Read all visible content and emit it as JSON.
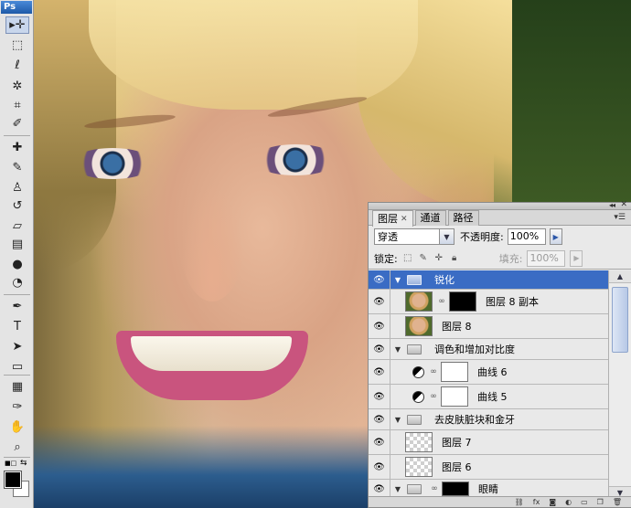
{
  "app": {
    "logo": "Ps"
  },
  "toolbox": {
    "tools": [
      {
        "name": "move-tool-icon",
        "glyph": "▸✛"
      },
      {
        "name": "marquee-tool-icon",
        "glyph": "⬚"
      },
      {
        "name": "lasso-tool-icon",
        "glyph": "ℓ"
      },
      {
        "name": "magic-wand-tool-icon",
        "glyph": "✲"
      },
      {
        "name": "crop-tool-icon",
        "glyph": "⌗"
      },
      {
        "name": "eyedropper-tool-icon",
        "glyph": "✐"
      },
      {
        "name": "healing-brush-tool-icon",
        "glyph": "✚"
      },
      {
        "name": "brush-tool-icon",
        "glyph": "✎"
      },
      {
        "name": "clone-stamp-tool-icon",
        "glyph": "♙"
      },
      {
        "name": "history-brush-tool-icon",
        "glyph": "↺"
      },
      {
        "name": "eraser-tool-icon",
        "glyph": "▱"
      },
      {
        "name": "gradient-tool-icon",
        "glyph": "▤"
      },
      {
        "name": "blur-tool-icon",
        "glyph": "●"
      },
      {
        "name": "dodge-tool-icon",
        "glyph": "◔"
      },
      {
        "name": "pen-tool-icon",
        "glyph": "✒"
      },
      {
        "name": "type-tool-icon",
        "glyph": "T"
      },
      {
        "name": "path-selection-tool-icon",
        "glyph": "➤"
      },
      {
        "name": "shape-tool-icon",
        "glyph": "▭"
      },
      {
        "name": "notes-tool-icon",
        "glyph": "▦"
      },
      {
        "name": "color-sampler-tool-icon",
        "glyph": "✑"
      },
      {
        "name": "hand-tool-icon",
        "glyph": "✋"
      },
      {
        "name": "zoom-tool-icon",
        "glyph": "⌕"
      }
    ]
  },
  "layers_panel": {
    "tabs": [
      {
        "label": "图层",
        "active": true
      },
      {
        "label": "通道",
        "active": false
      },
      {
        "label": "路径",
        "active": false
      }
    ],
    "blend_mode": "穿透",
    "opacity_label": "不透明度:",
    "opacity_value": "100%",
    "lock_label": "锁定:",
    "fill_label": "填充:",
    "fill_value": "100%",
    "layers": [
      {
        "name": "锐化",
        "type": "group",
        "selected": true,
        "indent": 0
      },
      {
        "name": "图层 8 副本",
        "type": "layer-mask",
        "selected": false,
        "indent": 1
      },
      {
        "name": "图层 8",
        "type": "photo",
        "selected": false,
        "indent": 1
      },
      {
        "name": "调色和增加对比度",
        "type": "group",
        "selected": false,
        "indent": 0
      },
      {
        "name": "曲线 6",
        "type": "adjustment",
        "selected": false,
        "indent": 1
      },
      {
        "name": "曲线 5",
        "type": "adjustment",
        "selected": false,
        "indent": 1
      },
      {
        "name": "去皮肤脏块和金牙",
        "type": "group",
        "selected": false,
        "indent": 0
      },
      {
        "name": "图层 7",
        "type": "transparent",
        "selected": false,
        "indent": 1
      },
      {
        "name": "图层 6",
        "type": "transparent",
        "selected": false,
        "indent": 1
      },
      {
        "name": "眼睛",
        "type": "group-mask",
        "selected": false,
        "indent": 0
      }
    ]
  }
}
